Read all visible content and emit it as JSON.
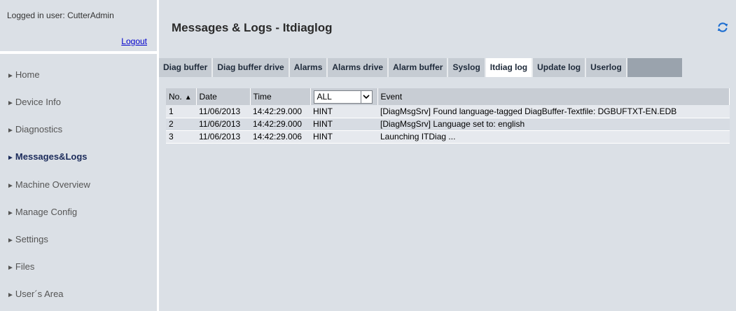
{
  "user": {
    "logged_in_label": "Logged in user: CutterAdmin",
    "logout": "Logout"
  },
  "header": {
    "title": "Messages & Logs - Itdiaglog",
    "refresh_icon": "refresh-icon"
  },
  "nav": {
    "items": [
      {
        "label": "Home",
        "active": false
      },
      {
        "label": "Device Info",
        "active": false
      },
      {
        "label": "Diagnostics",
        "active": false
      },
      {
        "label": "Messages&Logs",
        "active": true
      },
      {
        "label": "Machine Overview",
        "active": false
      },
      {
        "label": "Manage Config",
        "active": false
      },
      {
        "label": "Settings",
        "active": false
      },
      {
        "label": "Files",
        "active": false
      },
      {
        "label": "User´s Area",
        "active": false
      }
    ],
    "arrow": "►"
  },
  "tabs": [
    {
      "label": "Diag buffer",
      "active": false
    },
    {
      "label": "Diag buffer drive",
      "active": false
    },
    {
      "label": "Alarms",
      "active": false
    },
    {
      "label": "Alarms drive",
      "active": false
    },
    {
      "label": "Alarm buffer",
      "active": false
    },
    {
      "label": "Syslog",
      "active": false
    },
    {
      "label": "Itdiag log",
      "active": true
    },
    {
      "label": "Update log",
      "active": false
    },
    {
      "label": "Userlog",
      "active": false
    }
  ],
  "table": {
    "headers": {
      "no": "No.",
      "sort_arrow": "▲",
      "date": "Date",
      "time": "Time",
      "filter": "ALL",
      "event": "Event"
    },
    "rows": [
      {
        "no": "1",
        "date": "11/06/2013",
        "time": "14:42:29.000",
        "level": "HINT",
        "event": "[DiagMsgSrv] Found language-tagged DiagBuffer-Textfile: DGBUFTXT-EN.EDB"
      },
      {
        "no": "2",
        "date": "11/06/2013",
        "time": "14:42:29.000",
        "level": "HINT",
        "event": "[DiagMsgSrv] Language set to: english"
      },
      {
        "no": "3",
        "date": "11/06/2013",
        "time": "14:42:29.006",
        "level": "HINT",
        "event": "Launching ITDiag ..."
      }
    ]
  },
  "colors": {
    "panel_bg": "#dbe0e6",
    "tab_bg": "#c6ccd3",
    "tabbar_bg": "#9aa3ad",
    "active_text": "#1a2a5a",
    "refresh_icon": "#1f6fd1"
  }
}
